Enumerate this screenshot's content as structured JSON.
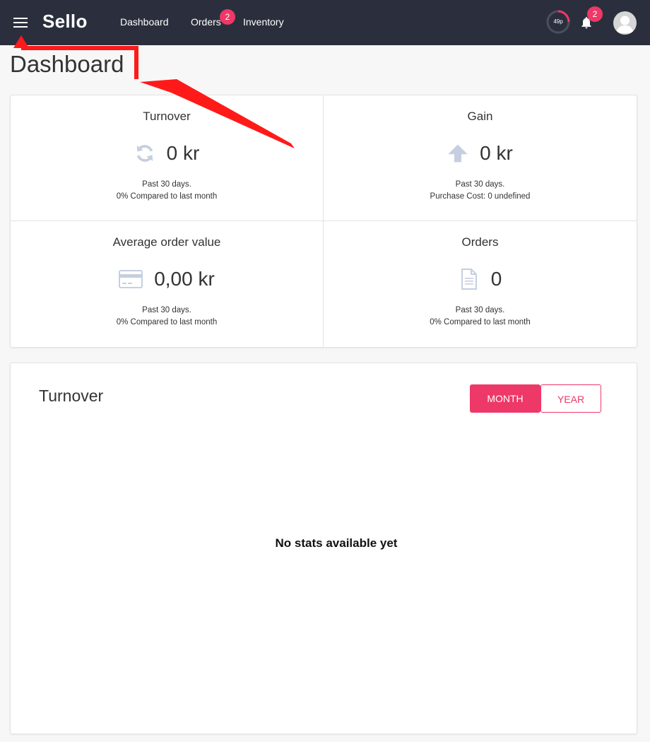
{
  "header": {
    "logo": "Sello",
    "nav": [
      {
        "label": "Dashboard"
      },
      {
        "label": "Orders",
        "badge": "2"
      },
      {
        "label": "Inventory"
      }
    ],
    "usage_label": "49p",
    "usage_fraction": 0.25,
    "notifications_badge": "2",
    "icons": [
      "menu-icon",
      "bell-icon",
      "user-avatar-icon"
    ]
  },
  "page": {
    "title": "Dashboard"
  },
  "stats": [
    {
      "title": "Turnover",
      "value": "0 kr",
      "icon": "refresh-icon",
      "line1": "Past 30 days.",
      "line2": "0% Compared to last month"
    },
    {
      "title": "Gain",
      "value": "0 kr",
      "icon": "arrow-up-icon",
      "line1": "Past 30 days.",
      "line2": "Purchase Cost: 0 undefined"
    },
    {
      "title": "Average order value",
      "value": "0,00 kr",
      "icon": "credit-card-icon",
      "line1": "Past 30 days.",
      "line2": "0% Compared to last month"
    },
    {
      "title": "Orders",
      "value": "0",
      "icon": "document-icon",
      "line1": "Past 30 days.",
      "line2": "0% Compared to last month"
    }
  ],
  "turnover_chart": {
    "title": "Turnover",
    "periods": [
      "MONTH",
      "YEAR"
    ],
    "selected_period": "MONTH",
    "empty_message": "No stats available yet"
  },
  "colors": {
    "topbar": "#2b2f3d",
    "accent": "#ee3868",
    "icon": "#c5cfe0",
    "annotation_arrow": "#ff1a1a"
  }
}
